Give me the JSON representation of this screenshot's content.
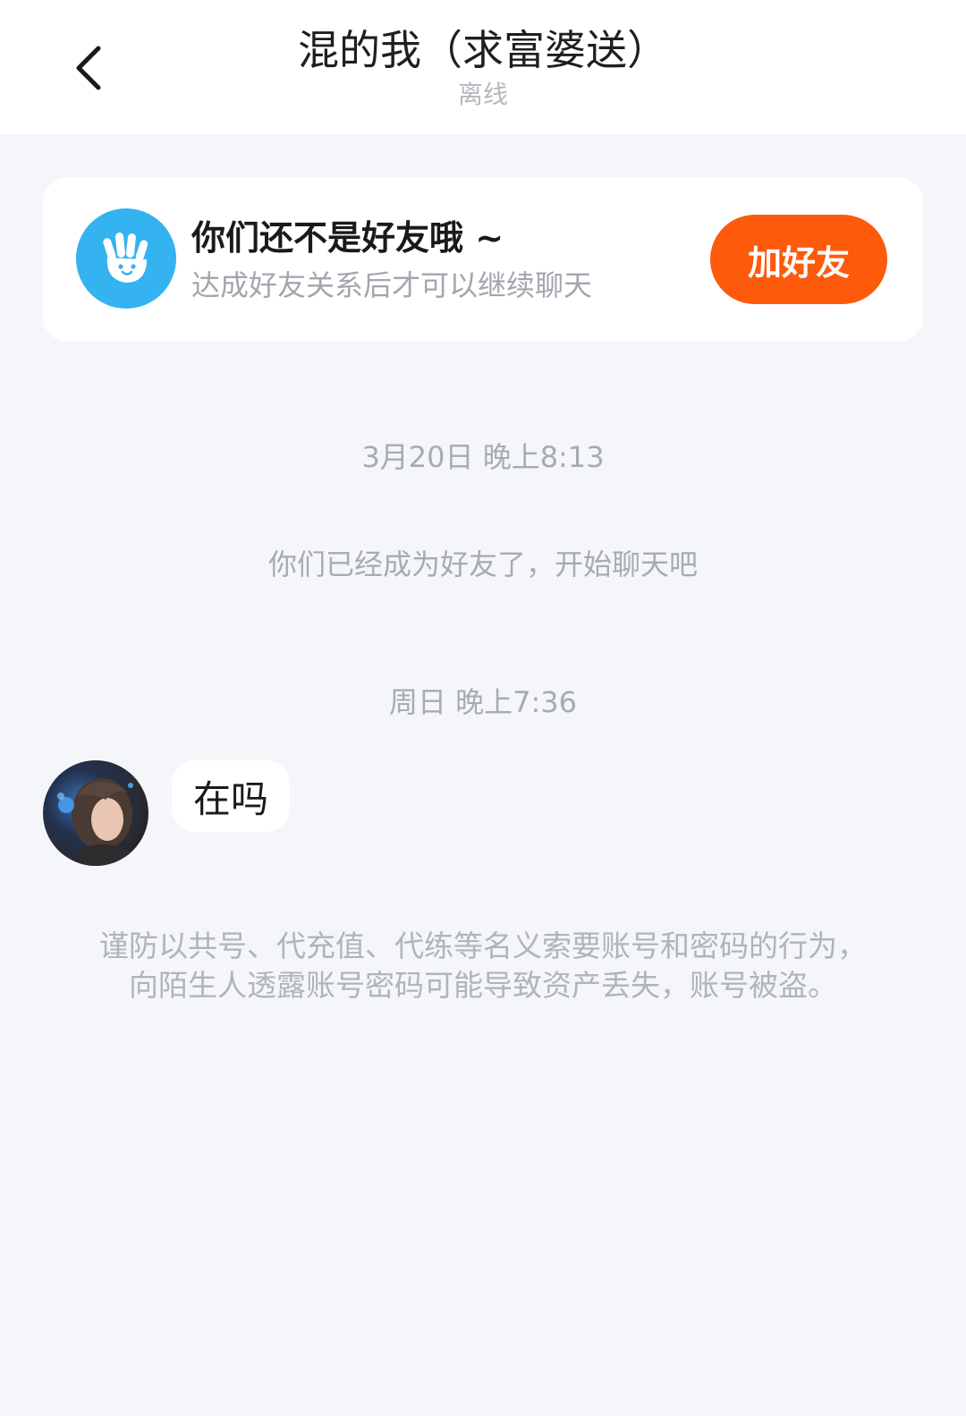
{
  "header": {
    "title": "混的我（求富婆送）",
    "status": "离线"
  },
  "friend_card": {
    "title": "你们还不是好友哦 ~",
    "subtitle": "达成好友关系后才可以继续聊天",
    "add_button": "加好友",
    "icon": "waving-hand-icon",
    "icon_color": "#35b2f0",
    "button_color": "#fd5a0c"
  },
  "chat": {
    "timestamp_1": "3月20日 晚上8:13",
    "system_message": "你们已经成为好友了，开始聊天吧",
    "timestamp_2": "周日 晚上7:36",
    "messages": [
      {
        "text": "在吗"
      }
    ],
    "security_notice": "谨防以共号、代充值、代练等名义索要账号和密码的行为，向陌生人透露账号密码可能导致资产丢失，账号被盗。"
  }
}
